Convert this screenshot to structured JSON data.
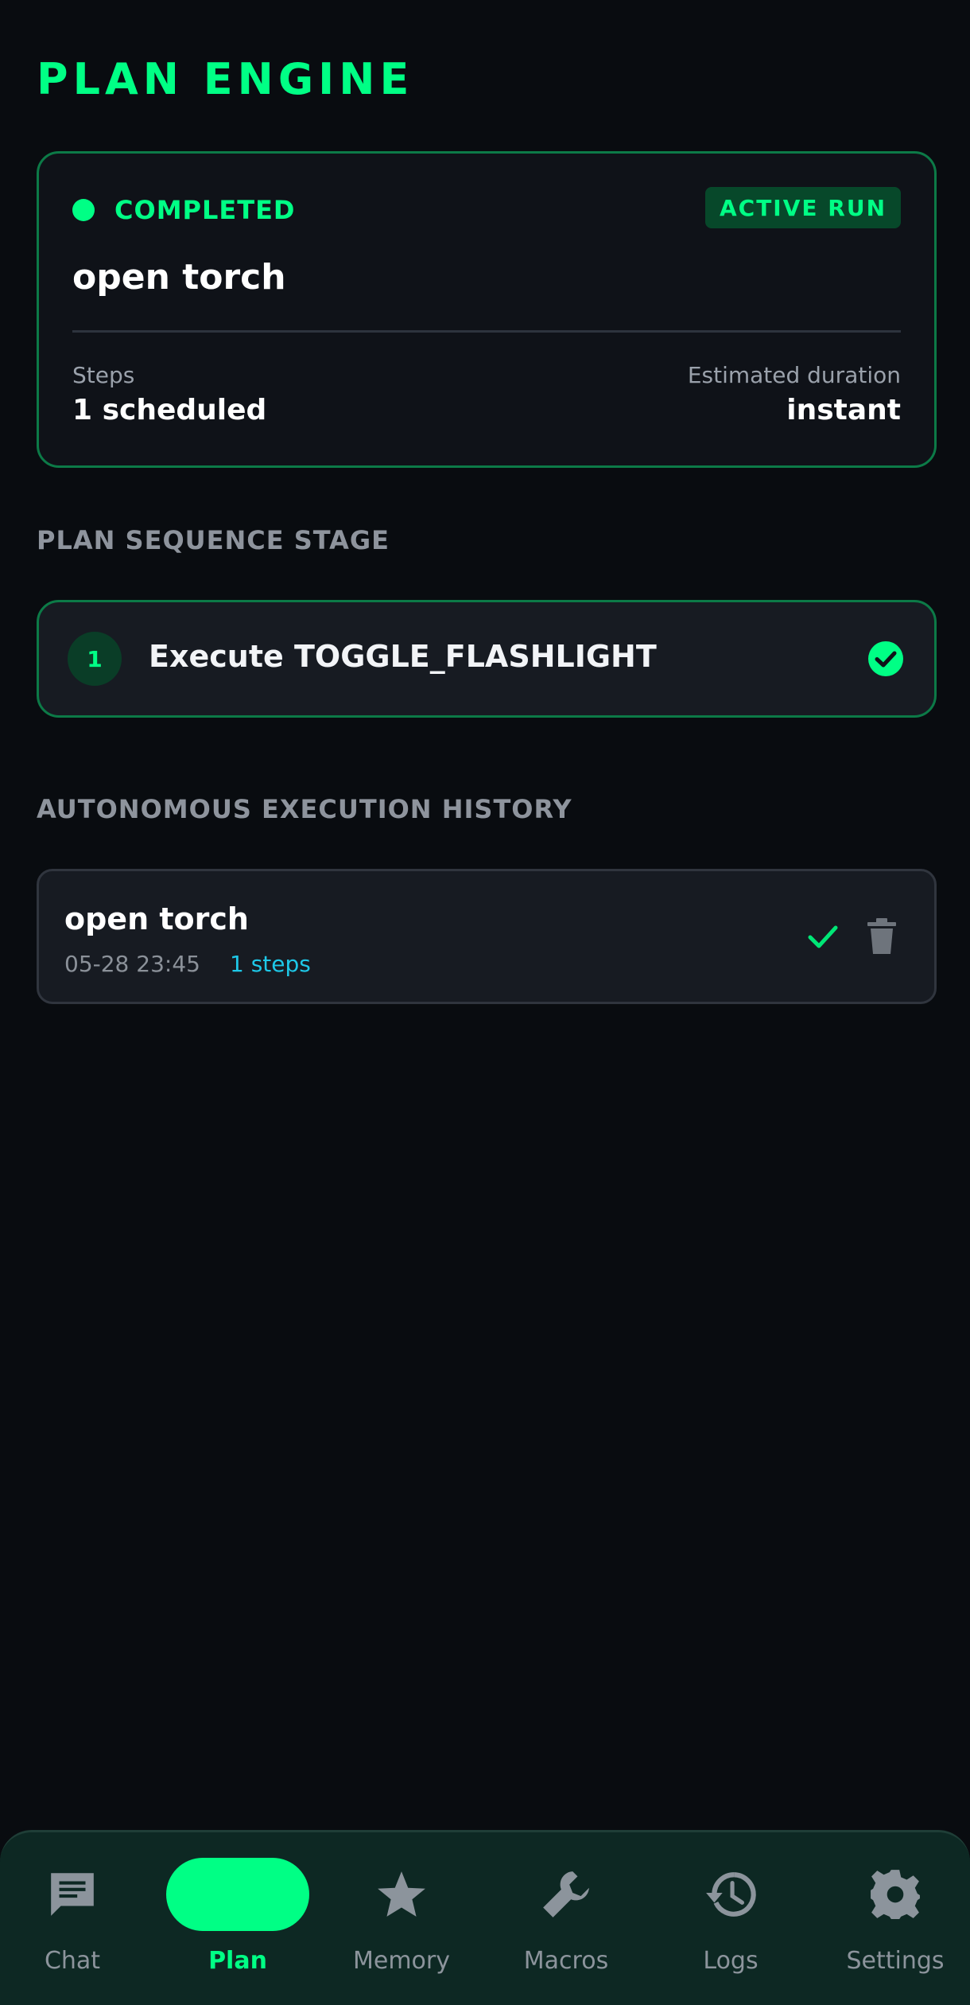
{
  "header": {
    "title": "PLAN ENGINE"
  },
  "active_run": {
    "status": "COMPLETED",
    "badge": "ACTIVE RUN",
    "plan_name": "open torch",
    "steps_label": "Steps",
    "steps_value": "1 scheduled",
    "duration_label": "Estimated duration",
    "duration_value": "instant"
  },
  "sequence": {
    "header": "PLAN SEQUENCE STAGE",
    "steps": [
      {
        "number": "1",
        "label": "Execute TOGGLE_FLASHLIGHT",
        "status_icon": "check-circle-icon"
      }
    ]
  },
  "history": {
    "header": "AUTONOMOUS EXECUTION HISTORY",
    "items": [
      {
        "title": "open torch",
        "date": "05-28 23:45",
        "steps": "1 steps"
      }
    ]
  },
  "nav": {
    "items": [
      {
        "label": "Chat",
        "icon": "chat-icon",
        "active": false
      },
      {
        "label": "Plan",
        "icon": "plan-icon",
        "active": true
      },
      {
        "label": "Memory",
        "icon": "star-icon",
        "active": false
      },
      {
        "label": "Macros",
        "icon": "wrench-icon",
        "active": false
      },
      {
        "label": "Logs",
        "icon": "history-icon",
        "active": false
      },
      {
        "label": "Settings",
        "icon": "gear-icon",
        "active": false
      }
    ]
  },
  "colors": {
    "accent": "#00ff85",
    "background": "#090c10",
    "card": "#0f1218",
    "link": "#1ec8e8",
    "nav_bg": "#0d2823"
  }
}
